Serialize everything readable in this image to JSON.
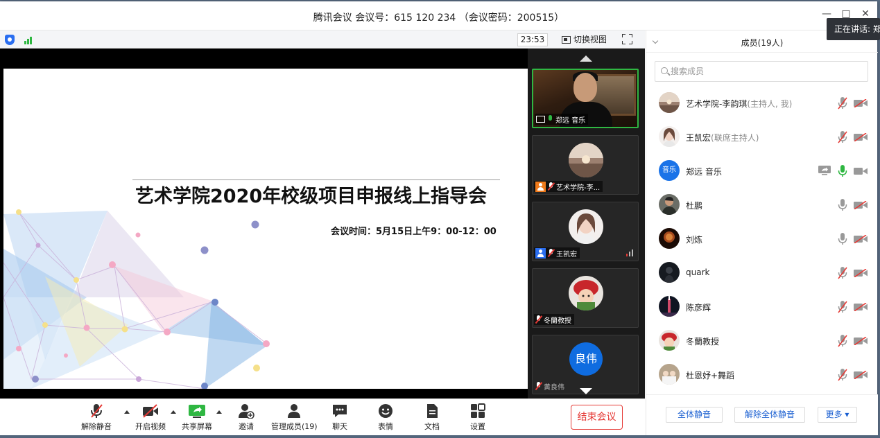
{
  "window": {
    "title": "腾讯会议 会议号：615 120 234 （会议密码：200515）",
    "speaking_tooltip": "正在讲话: 郑"
  },
  "meeting_toolbar": {
    "timer": "23:53",
    "switch_view_label": "切换视图"
  },
  "slide": {
    "title": "艺术学院2020年校级项目申报线上指导会",
    "time_line": "会议时间：5月15日上午9：00-12：00"
  },
  "video_tiles": [
    {
      "name": "郑远 音乐",
      "type": "camera",
      "active": true
    },
    {
      "name": "艺术学院-李...",
      "type": "avatar",
      "badge": "orange"
    },
    {
      "name": "王凯宏",
      "type": "avatar",
      "badge": "blue"
    },
    {
      "name": "冬蘭教授",
      "type": "avatar"
    },
    {
      "name": "黄良伟",
      "type": "text-avatar",
      "avatar_text": "良伟"
    }
  ],
  "bottom_toolbar": {
    "unmute": "解除静音",
    "start_video": "开启视频",
    "share_screen": "共享屏幕",
    "invite": "邀请",
    "manage_members": "管理成员(19)",
    "chat": "聊天",
    "emoji": "表情",
    "docs": "文档",
    "settings": "设置",
    "end_meeting": "结束会议"
  },
  "panel": {
    "title": "成员(19人)",
    "search_placeholder": "搜索成员",
    "members": [
      {
        "name": "艺术学院-李韵琪",
        "role": "(主持人, 我)",
        "mic": "muted",
        "cam": "off",
        "avatar": "landscape"
      },
      {
        "name": "王凯宏",
        "role": "(联席主持人)",
        "mic": "muted",
        "cam": "off",
        "avatar": "woman"
      },
      {
        "name": "郑远 音乐",
        "role": "",
        "mic": "on",
        "cam": "on-gray",
        "share": true,
        "avatar_text": "音乐"
      },
      {
        "name": "杜鹏",
        "role": "",
        "mic": "off-gray",
        "cam": "off",
        "avatar": "man-dark"
      },
      {
        "name": "刘炼",
        "role": "",
        "mic": "off-gray",
        "cam": "off",
        "avatar": "man-red"
      },
      {
        "name": "quark",
        "role": "",
        "mic": "muted",
        "cam": "off",
        "avatar": "night"
      },
      {
        "name": "陈彦辉",
        "role": "",
        "mic": "muted",
        "cam": "off",
        "avatar": "tower"
      },
      {
        "name": "冬蘭教授",
        "role": "",
        "mic": "muted",
        "cam": "off",
        "avatar": "doll"
      },
      {
        "name": "杜恩妤+舞蹈",
        "role": "",
        "mic": "muted",
        "cam": "off",
        "avatar": "group"
      }
    ],
    "mute_all": "全体静音",
    "unmute_all": "解除全体静音",
    "more": "更多 ▾"
  },
  "colors": {
    "accent_blue": "#1a5fd1",
    "danger_red": "#e53935",
    "active_green": "#2fb742"
  }
}
